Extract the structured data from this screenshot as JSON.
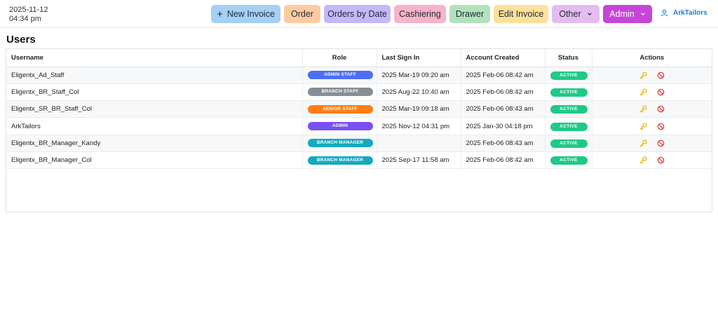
{
  "header": {
    "date": "2025-11-12",
    "time": "04:34 pm",
    "nav": [
      {
        "id": "new-invoice",
        "label": "New Invoice",
        "color": "#a5d0f5",
        "icon": "plus-icon"
      },
      {
        "id": "order",
        "label": "Order",
        "color": "#fecba1"
      },
      {
        "id": "orders-by-date",
        "label": "Orders by Date",
        "color": "#c5b8f8"
      },
      {
        "id": "cashiering",
        "label": "Cashiering",
        "color": "#f7b3c9"
      },
      {
        "id": "drawer",
        "label": "Drawer",
        "color": "#b2e2bc"
      },
      {
        "id": "edit-invoice",
        "label": "Edit Invoice",
        "color": "#fee09a"
      },
      {
        "id": "other",
        "label": "Other",
        "color": "#e3bdf0",
        "icon": "chevron-down-icon"
      },
      {
        "id": "admin",
        "label": "Admin",
        "color": "#c545d6",
        "text_color": "#ffffff",
        "icon": "chevron-down-icon"
      }
    ],
    "user": {
      "name": "ArkTailors",
      "icon": "user-icon",
      "color": "#1c7ed6"
    }
  },
  "page": {
    "title": "Users"
  },
  "table": {
    "columns": [
      "Username",
      "Role",
      "Last Sign In",
      "Account Created",
      "Status",
      "Actions"
    ],
    "role_colors": {
      "ADMIN STAFF": "#4c6ef5",
      "BRANCH STAFF": "#868e96",
      "SENIOR STAFF": "#fd7e14",
      "ADMIN": "#7950f2",
      "BRANCH MANAGER": "#15aabf"
    },
    "status_color": "#20c987",
    "action_icons": [
      {
        "name": "key-icon",
        "color": "#f0b400"
      },
      {
        "name": "ban-icon",
        "color": "#e03131"
      }
    ],
    "rows": [
      {
        "username": "Eligentx_Ad_Staff",
        "role": "ADMIN STAFF",
        "last_sign_in": "2025 Mar-19 09:20 am",
        "created": "2025 Feb-06 08:42 am",
        "status": "ACTIVE"
      },
      {
        "username": "Eligentx_BR_Staff_Col",
        "role": "BRANCH STAFF",
        "last_sign_in": "2025 Aug-22 10:40 am",
        "created": "2025 Feb-06 08:42 am",
        "status": "ACTIVE"
      },
      {
        "username": "Eligentx_SR_BR_Staff_Col",
        "role": "SENIOR STAFF",
        "last_sign_in": "2025 Mar-19 09:18 am",
        "created": "2025 Feb-06 08:43 am",
        "status": "ACTIVE"
      },
      {
        "username": "ArkTailors",
        "role": "ADMIN",
        "last_sign_in": "2025 Nov-12 04:31 pm",
        "created": "2025 Jan-30 04:18 pm",
        "status": "ACTIVE"
      },
      {
        "username": "Eligentx_BR_Manager_Kandy",
        "role": "BRANCH MANAGER",
        "last_sign_in": "",
        "created": "2025 Feb-06 08:43 am",
        "status": "ACTIVE"
      },
      {
        "username": "Eligentx_BR_Manager_Col",
        "role": "BRANCH MANAGER",
        "last_sign_in": "2025 Sep-17 11:58 am",
        "created": "2025 Feb-06 08:42 am",
        "status": "ACTIVE"
      }
    ]
  }
}
